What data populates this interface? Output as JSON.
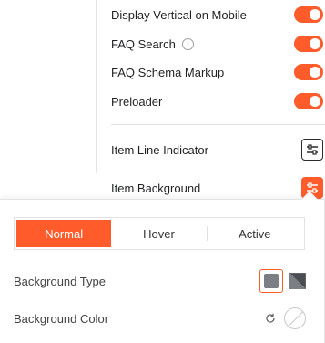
{
  "settings": {
    "rows": [
      {
        "label": "Display Vertical on Mobile",
        "toggle": "on"
      },
      {
        "label": "FAQ Search",
        "toggle": "on",
        "info_icon": "info-icon"
      },
      {
        "label": "FAQ Schema Markup",
        "toggle": "on"
      },
      {
        "label": "Preloader",
        "toggle": "on"
      }
    ],
    "item_line_indicator": {
      "label": "Item Line Indicator",
      "icon": "sliders-icon"
    },
    "item_background": {
      "label": "Item Background",
      "icon": "sliders-icon"
    }
  },
  "popover": {
    "tabs": [
      {
        "label": "Normal",
        "active": true
      },
      {
        "label": "Hover",
        "active": false
      },
      {
        "label": "Active",
        "active": false
      }
    ],
    "background_type": {
      "label": "Background Type",
      "options": [
        "classic-icon",
        "gradient-icon"
      ],
      "selected": "classic-icon"
    },
    "background_color": {
      "label": "Background Color",
      "icons": [
        "reset-icon",
        "color-swatch"
      ]
    }
  },
  "colors": {
    "accent": "#ff5b2b",
    "text": "#1f2124",
    "muted": "#9aa0a6"
  }
}
